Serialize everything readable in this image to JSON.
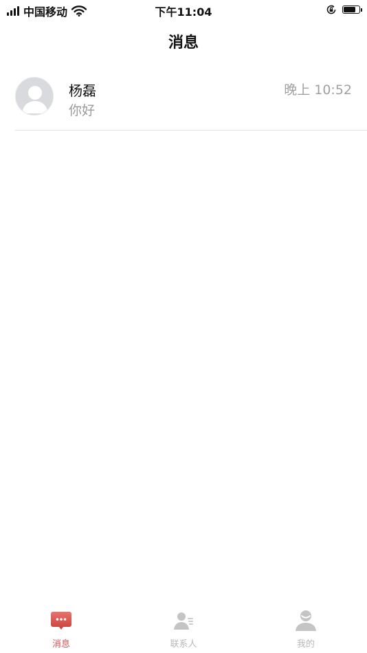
{
  "status_bar": {
    "carrier": "中国移动",
    "time": "下午11:04",
    "battery_level": 0.8
  },
  "header": {
    "title": "消息"
  },
  "conversations": [
    {
      "name": "杨磊",
      "preview": "你好",
      "time": "晚上 10:52",
      "avatar_icon": "default-avatar-icon"
    }
  ],
  "tabs": [
    {
      "label": "消息",
      "icon": "chat-bubble-icon",
      "active": true
    },
    {
      "label": "联系人",
      "icon": "contacts-icon",
      "active": false
    },
    {
      "label": "我的",
      "icon": "profile-icon",
      "active": false
    }
  ],
  "colors": {
    "accent": "#d9534f",
    "inactive": "#b9b9b9",
    "secondary_text": "#9a9a9a",
    "divider": "#e2e2e2"
  }
}
